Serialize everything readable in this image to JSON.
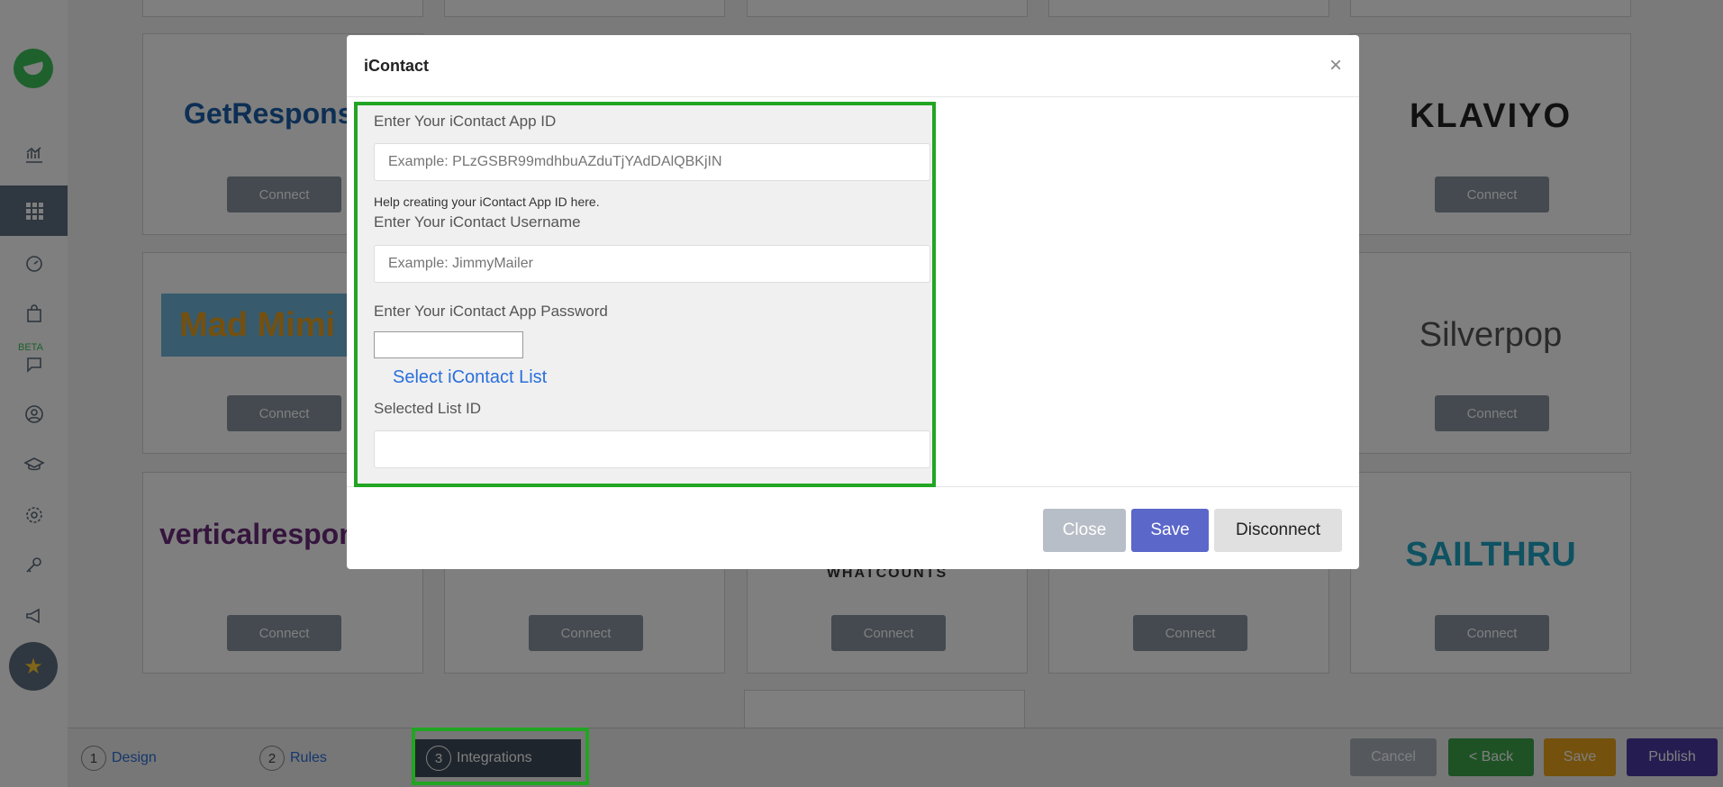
{
  "sidebar": {
    "beta_label": "BETA"
  },
  "cards": {
    "connect_label": "Connect",
    "logos": [
      "GetResponse",
      "KLAVIYO",
      "Mad Mimi",
      "Silverpop",
      "verticalresponse",
      "WHATCOUNTS",
      "SAILTHRU"
    ]
  },
  "modal": {
    "title": "iContact",
    "close_symbol": "×",
    "app_id_label": "Enter Your iContact App ID",
    "app_id_placeholder": "Example: PLzGSBR99mdhbuAZduTjYAdDAlQBKjIN",
    "help_text": "Help creating your iContact App ID here.",
    "username_label": "Enter Your iContact Username",
    "username_placeholder": "Example: JimmyMailer",
    "password_label": "Enter Your iContact App Password",
    "select_list_link": "Select iContact List",
    "selected_list_label": "Selected List ID",
    "buttons": {
      "close": "Close",
      "save": "Save",
      "disconnect": "Disconnect"
    }
  },
  "steps": [
    {
      "num": "1",
      "label": "Design"
    },
    {
      "num": "2",
      "label": "Rules"
    },
    {
      "num": "3",
      "label": "Integrations"
    }
  ],
  "bottom_buttons": {
    "cancel": "Cancel",
    "back": "< Back",
    "save": "Save",
    "publish": "Publish"
  },
  "colors": {
    "accent_green": "#22a522",
    "save_blue": "#5b67c9",
    "publish_purple": "#4a3aa3",
    "bottom_save_orange": "#e9a21a",
    "back_green": "#3ca54a"
  }
}
